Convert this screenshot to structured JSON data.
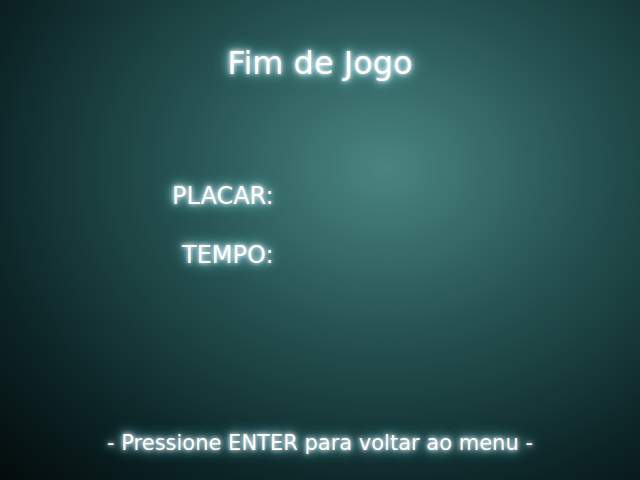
{
  "title": "Fim de Jogo",
  "stats": [
    {
      "label": "PLACAR:"
    },
    {
      "label": "TEMPO:"
    }
  ],
  "prompt": "- Pressione ENTER para voltar ao menu -"
}
